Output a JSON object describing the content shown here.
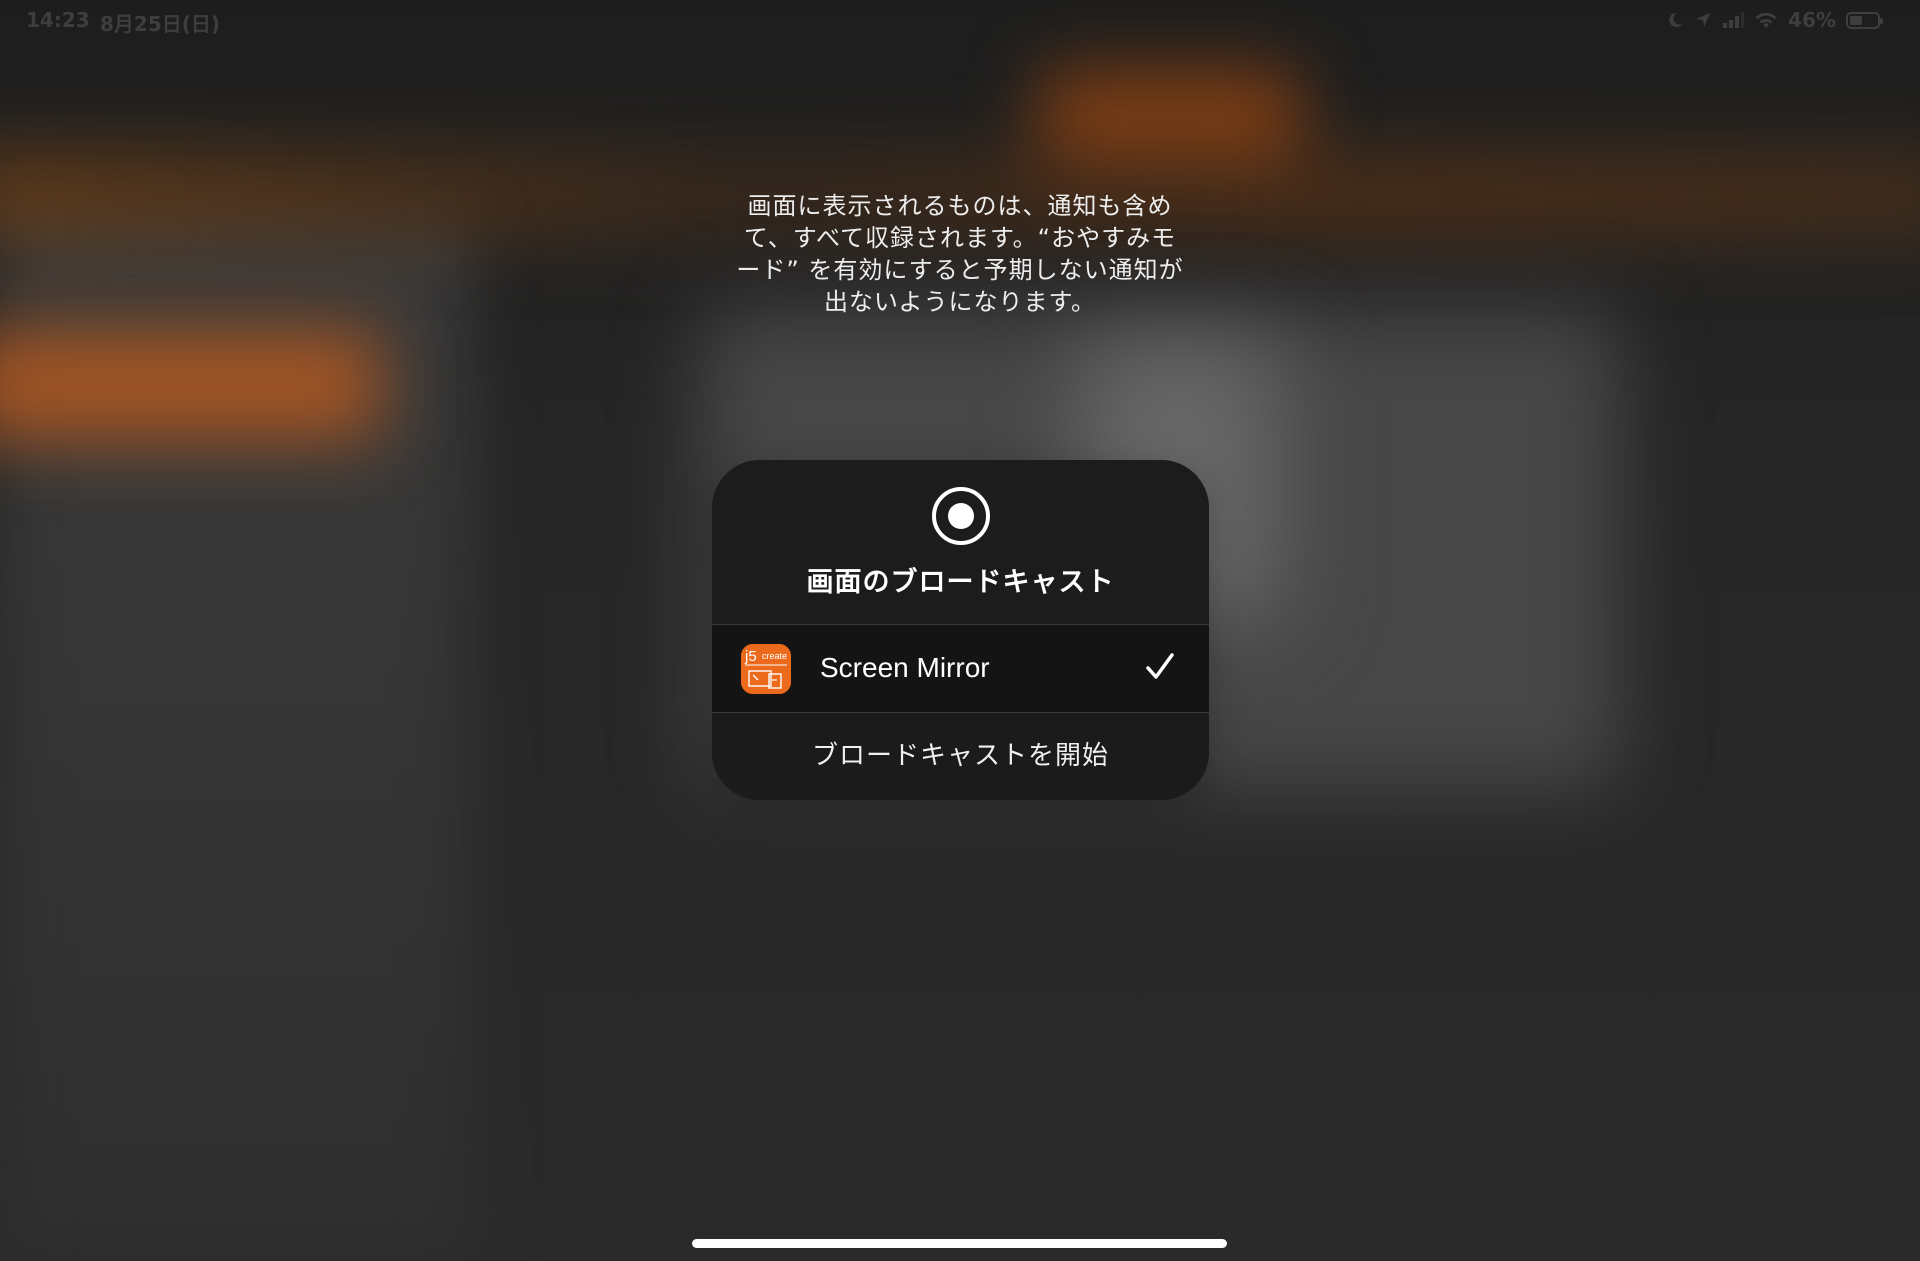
{
  "status_bar": {
    "time": "14:23",
    "date": "8月25日(日)",
    "battery_percent": "46%",
    "battery_level": 0.46,
    "icons": [
      "moon-icon",
      "location-icon",
      "cellular-signal-icon",
      "wifi-icon",
      "battery-icon"
    ]
  },
  "info": {
    "message_lines": [
      "画面に表示されるものは、通知も含め",
      "て、すべて収録されます。“おやすみモ",
      "ード” を有効にすると予期しない通知が",
      "出ないようになります。"
    ]
  },
  "dialog": {
    "icon": "screen-record-icon",
    "title": "画面のブロードキャスト",
    "selected_app": {
      "name": "Screen Mirror",
      "icon": "j5create-app-icon",
      "icon_text": "j5create",
      "selected": true
    },
    "start_button": "ブロードキャストを開始"
  },
  "colors": {
    "app_icon_orange": "#ec6a1b",
    "dialog_background": "#1b1b1b",
    "text": "#ffffff"
  }
}
